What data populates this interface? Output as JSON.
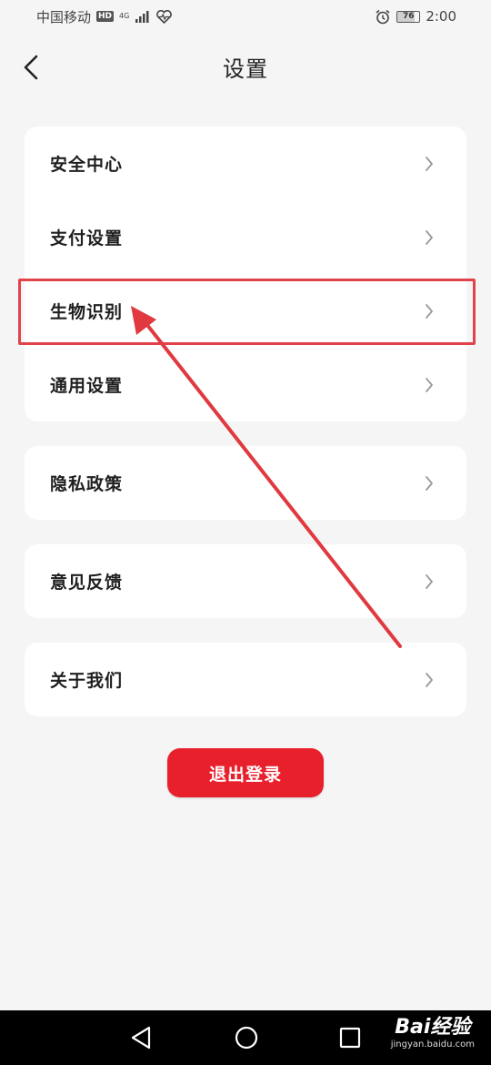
{
  "status_bar": {
    "carrier": "中国移动",
    "hd": "HD",
    "network": "4G",
    "battery": "76",
    "time": "2:00"
  },
  "header": {
    "title": "设置"
  },
  "settings": {
    "group1": [
      {
        "label": "安全中心"
      },
      {
        "label": "支付设置"
      },
      {
        "label": "生物识别"
      },
      {
        "label": "通用设置"
      }
    ],
    "privacy": {
      "label": "隐私政策"
    },
    "feedback": {
      "label": "意见反馈"
    },
    "about": {
      "label": "关于我们"
    }
  },
  "logout": {
    "label": "退出登录"
  },
  "colors": {
    "accent": "#e8202c",
    "annotation": "#e0444a",
    "background": "#f5f5f5"
  },
  "watermark": {
    "logo": "Bai经验",
    "url": "jingyan.baidu.com"
  }
}
